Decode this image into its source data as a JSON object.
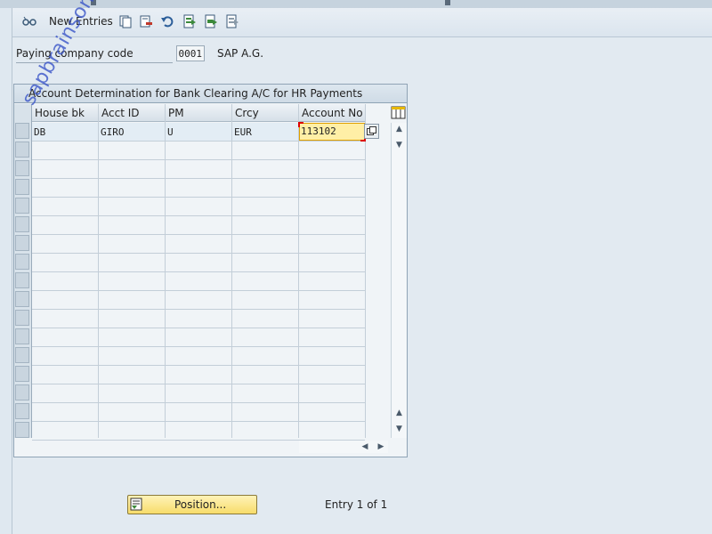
{
  "toolbar": {
    "new_entries_label": "New Entries",
    "icons": [
      "glasses-icon",
      "copy-icon",
      "delete-icon",
      "undo-icon",
      "select-all-icon",
      "select-block-icon",
      "deselect-all-icon"
    ]
  },
  "header": {
    "paying_company_code_label": "Paying company code",
    "paying_company_code_value": "0001",
    "company_name": "SAP A.G."
  },
  "table": {
    "title": "Account Determination for Bank Clearing A/C for HR Payments",
    "columns": [
      "House bk",
      "Acct ID",
      "PM",
      "Crcy",
      "Account No"
    ],
    "rows": [
      {
        "house_bk": "DB",
        "acct_id": "GIRO",
        "pm": "U",
        "crcy": "EUR",
        "account_no": "113102"
      }
    ]
  },
  "footer": {
    "position_button_label": "Position...",
    "entry_text": "Entry 1 of 1"
  },
  "watermark": "sapbrainsonline.com",
  "colors": {
    "background": "#dfe8f0",
    "input_highlight": "#ffefa6",
    "button_yellow": "#f7dc6a",
    "watermark": "#3a55c8"
  }
}
